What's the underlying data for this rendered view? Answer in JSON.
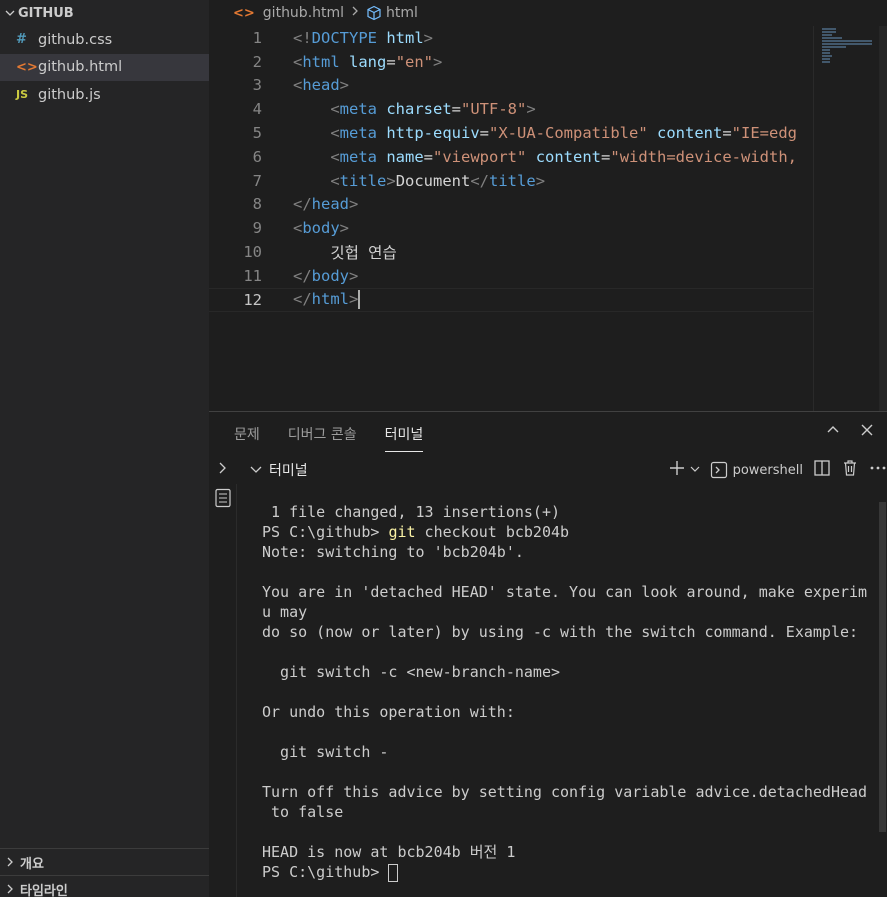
{
  "sidebar": {
    "folder": "GITHUB",
    "files": [
      {
        "icon": "#",
        "name": "github.css",
        "type": "css"
      },
      {
        "icon": "<>",
        "name": "github.html",
        "type": "html",
        "active": true
      },
      {
        "icon": "JS",
        "name": "github.js",
        "type": "js"
      }
    ],
    "outline": "개요",
    "timeline": "타임라인"
  },
  "breadcrumb": {
    "file": "github.html",
    "symbol": "html"
  },
  "editor": {
    "line_numbers": [
      "1",
      "2",
      "3",
      "4",
      "5",
      "6",
      "7",
      "8",
      "9",
      "10",
      "11",
      "12"
    ],
    "current_line": 12,
    "body_text": "깃헙 연습"
  },
  "panel": {
    "tabs": [
      "문제",
      "디버그 콘솔",
      "터미널"
    ],
    "active_tab": "터미널",
    "terminal_title": "터미널",
    "shell": "powershell"
  },
  "terminal": {
    "lines": [
      " 1 file changed, 13 insertions(+)",
      "PS C:\\github> ",
      "Note: switching to 'bcb204b'.",
      "",
      "You are in 'detached HEAD' state. You can look around, make experim",
      "u may",
      "do so (now or later) by using -c with the switch command. Example:",
      "",
      "  git switch -c <new-branch-name>",
      "",
      "Or undo this operation with:",
      "",
      "  git switch -",
      "",
      "Turn off this advice by setting config variable advice.detachedHead",
      " to false",
      "",
      "HEAD is now at bcb204b 버전 1",
      "PS C:\\github> "
    ],
    "git_cmd": "git",
    "git_args": " checkout bcb204b"
  },
  "colors": {
    "sidebar_bg": "#252526",
    "editor_bg": "#1e1e1e",
    "tag": "#569cd6",
    "attr": "#9cdcfe",
    "string": "#ce9178",
    "git_cmd": "#f9f1a5"
  }
}
